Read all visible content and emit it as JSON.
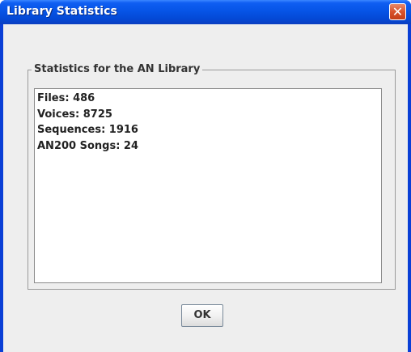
{
  "window": {
    "title": "Library Statistics",
    "close_glyph": "✕",
    "close_icon": "close-icon"
  },
  "group": {
    "legend": "Statistics for the AN Library"
  },
  "stats": [
    "Files: 486",
    "Voices: 8725",
    "Sequences: 1916",
    "AN200 Songs: 24"
  ],
  "buttons": {
    "ok_label": "OK"
  },
  "colors": {
    "titlebar": "#0654e6",
    "close_button": "#d8532c",
    "client_background": "#eeeeee"
  }
}
